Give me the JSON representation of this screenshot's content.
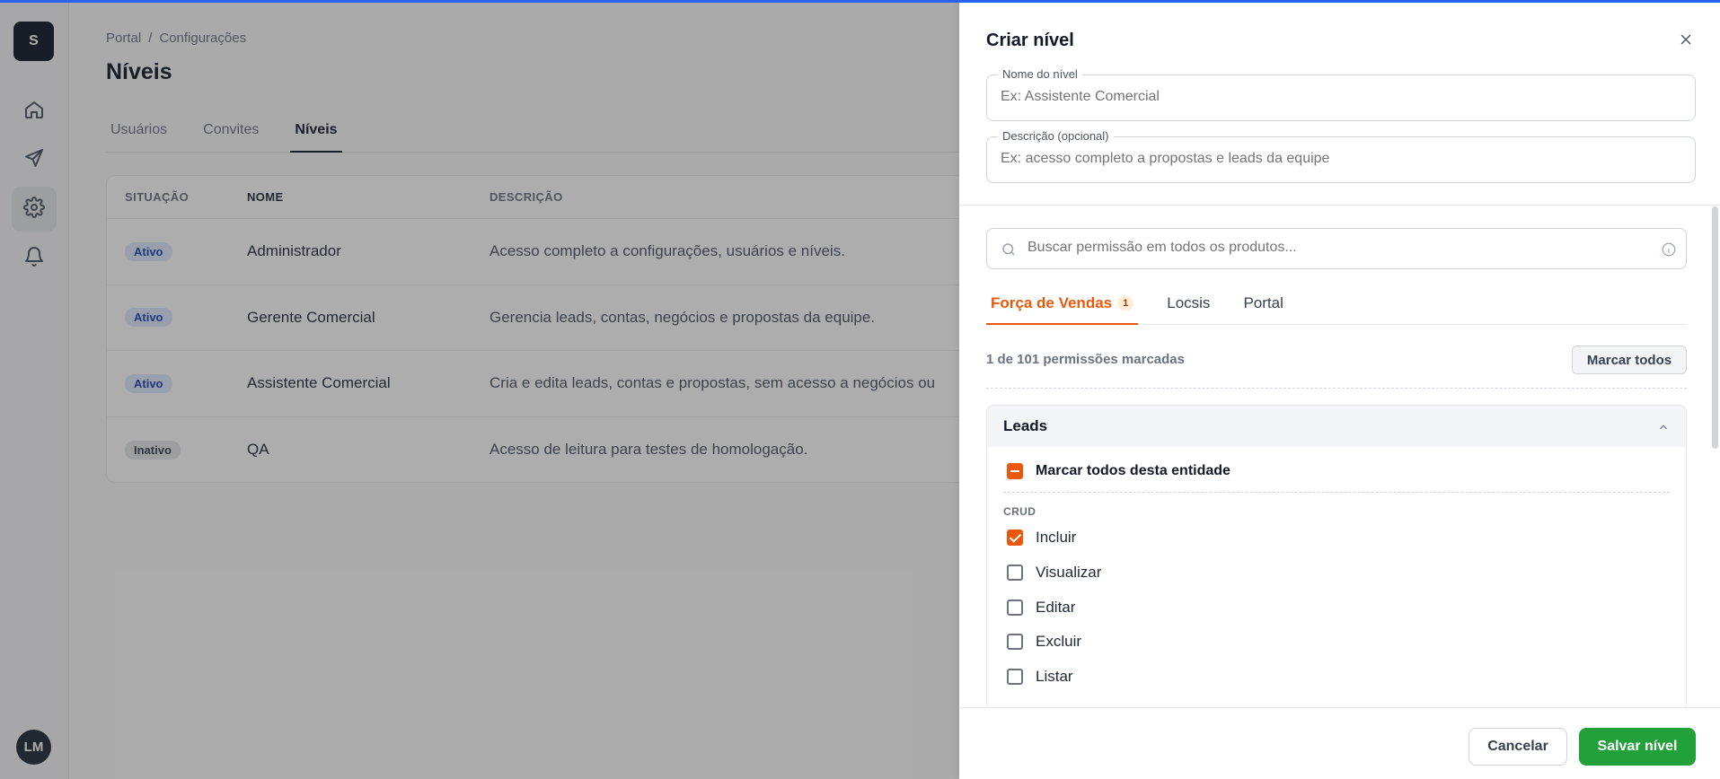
{
  "app": {
    "logo_letter": "S",
    "user_initials": "LM"
  },
  "colors": {
    "accent": "#ea580c",
    "save": "#22a03a",
    "badge_active_bg": "#dbeafe",
    "badge_active_text": "#1e40af"
  },
  "sidebar": {
    "items": [
      {
        "icon": "home-icon"
      },
      {
        "icon": "send-icon"
      },
      {
        "icon": "gear-icon",
        "active": true
      },
      {
        "icon": "bell-icon"
      }
    ]
  },
  "breadcrumb": {
    "root": "Portal",
    "separator": "/",
    "current": "Configurações"
  },
  "page": {
    "title": "Níveis"
  },
  "tabs": [
    {
      "label": "Usuários"
    },
    {
      "label": "Convites"
    },
    {
      "label": "Níveis",
      "active": true
    }
  ],
  "table": {
    "headers": [
      "SITUAÇÃO",
      "NOME",
      "DESCRIÇÃO"
    ],
    "rows": [
      {
        "status": "Ativo",
        "name": "Administrador",
        "description": "Acesso completo a configurações, usuários e níveis."
      },
      {
        "status": "Ativo",
        "name": "Gerente Comercial",
        "description": "Gerencia leads, contas, negócios e propostas da equipe."
      },
      {
        "status": "Ativo",
        "name": "Assistente Comercial",
        "description": "Cria e edita leads, contas e propostas, sem acesso a negócios ou"
      },
      {
        "status": "Inativo",
        "name": "QA",
        "description": "Acesso de leitura para testes de homologação."
      }
    ]
  },
  "drawer": {
    "title": "Criar nível",
    "name_field": {
      "label": "Nome do nível",
      "placeholder": "Ex: Assistente Comercial"
    },
    "desc_field": {
      "label": "Descrição (opcional)",
      "placeholder": "Ex: acesso completo a propostas e leads da equipe"
    },
    "search": {
      "placeholder": "Buscar permissão em todos os produtos..."
    },
    "product_tabs": [
      {
        "label": "Força de Vendas",
        "count": "1",
        "active": true
      },
      {
        "label": "Locsis"
      },
      {
        "label": "Portal"
      }
    ],
    "perm_count": "1 de 101 permissões marcadas",
    "mark_all": "Marcar todos",
    "entity": {
      "name": "Leads",
      "mark_all_entity": "Marcar todos desta entidade",
      "group_label": "CRUD",
      "permissions": [
        {
          "label": "Incluir",
          "checked": true
        },
        {
          "label": "Visualizar",
          "checked": false
        },
        {
          "label": "Editar",
          "checked": false
        },
        {
          "label": "Excluir",
          "checked": false
        },
        {
          "label": "Listar",
          "checked": false
        }
      ]
    },
    "footer": {
      "cancel": "Cancelar",
      "save": "Salvar nível"
    }
  }
}
